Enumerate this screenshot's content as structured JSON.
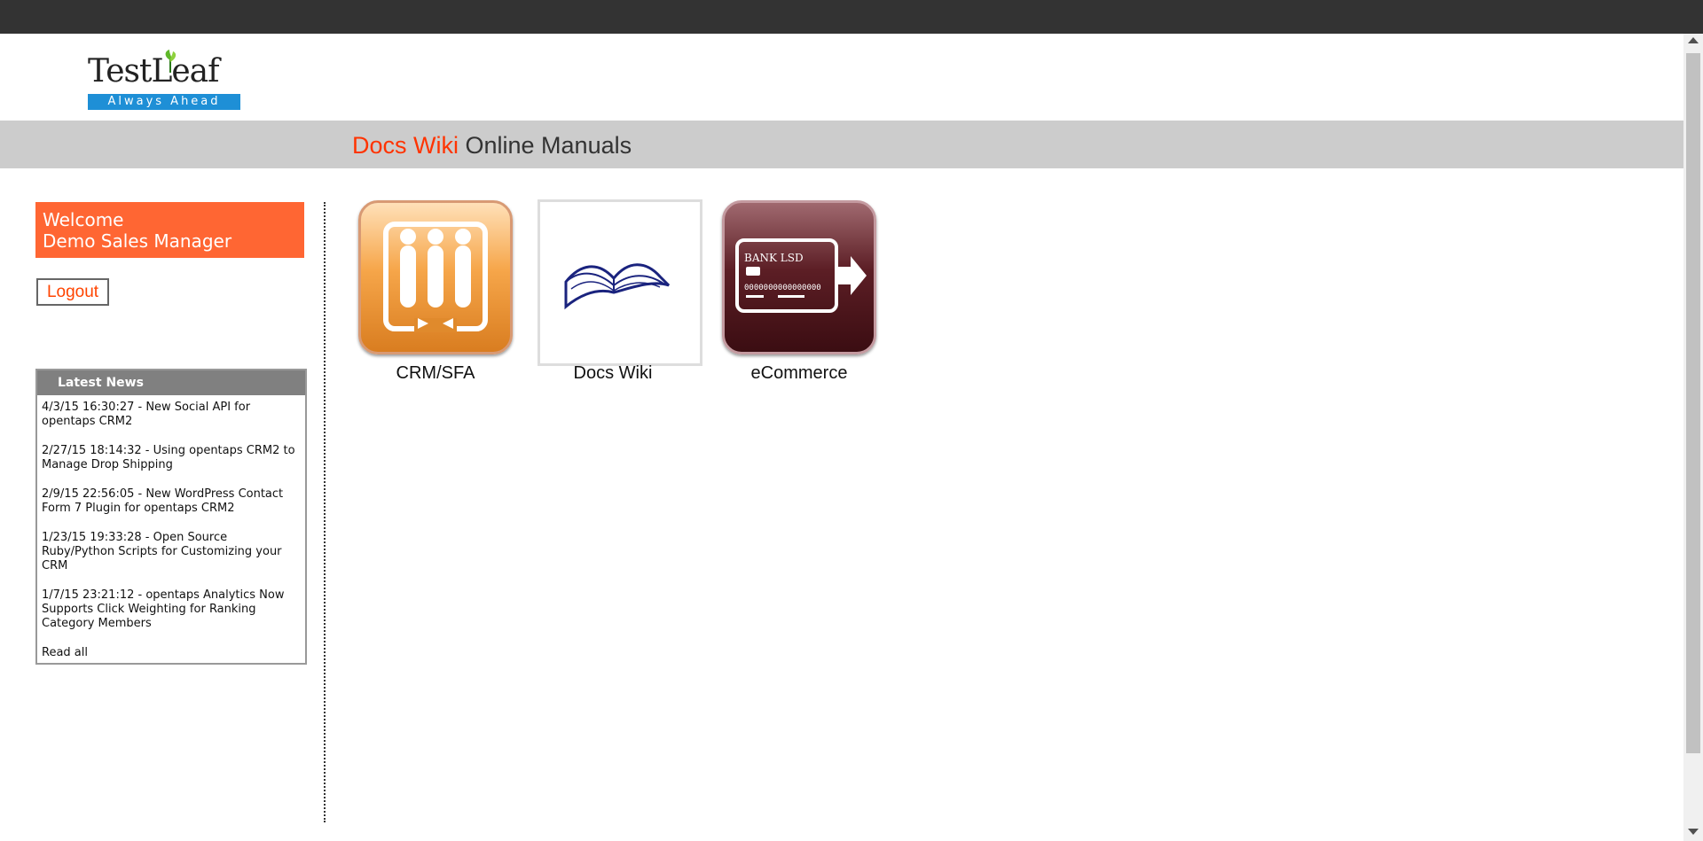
{
  "brand": {
    "logo_text": "TestLeaf",
    "logo_tagline": "Always Ahead"
  },
  "title": {
    "highlight": "Docs Wiki",
    "rest": " Online Manuals"
  },
  "sidebar": {
    "welcome_line1": "Welcome",
    "welcome_line2": "Demo Sales Manager",
    "logout_label": "Logout",
    "news": {
      "heading": "Latest News",
      "items": [
        "4/3/15 16:30:27 - New Social API for opentaps CRM2",
        "2/27/15 18:14:32 - Using opentaps CRM2 to Manage Drop Shipping",
        "2/9/15 22:56:05 - New WordPress Contact Form 7 Plugin for opentaps CRM2",
        "1/23/15 19:33:28 - Open Source Ruby/Python Scripts for Customizing your CRM",
        "1/7/15 23:21:12 - opentaps Analytics Now Supports Click Weighting for Ranking Category Members"
      ],
      "read_all": "Read all"
    }
  },
  "apps": [
    {
      "label": "CRM/SFA",
      "icon": "crm-sfa-icon"
    },
    {
      "label": "Docs Wiki",
      "icon": "open-book-icon"
    },
    {
      "label": "eCommerce",
      "icon": "bank-card-icon"
    }
  ],
  "card_text": {
    "bank": "BANK LSD",
    "number": "0000000000000000"
  },
  "colors": {
    "accent_orange": "#ff6633",
    "title_red": "#ff3300",
    "topbar": "#333333",
    "titlebar": "#cccccc"
  }
}
